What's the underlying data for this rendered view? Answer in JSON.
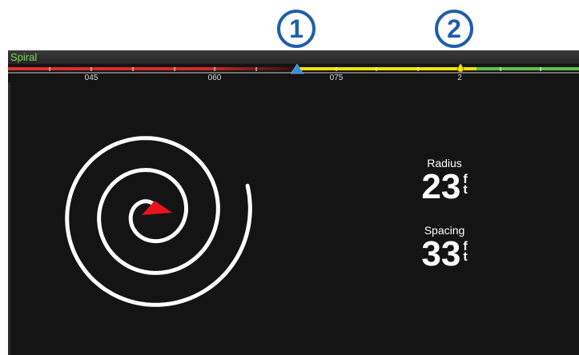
{
  "callouts": [
    "1",
    "2"
  ],
  "screen": {
    "title": "Spiral",
    "heading_ticks": [
      "045",
      "060",
      "075",
      "2"
    ],
    "colors": {
      "title": "#7ed957",
      "port_bar": "#e0302f",
      "course_line": "#f2e600",
      "starboard_bar": "#5cc445",
      "heading_marker": "#3a8fd6",
      "waypoint_marker": "#f2e600",
      "boat": "#e8141c",
      "spiral": "#ffffff"
    },
    "icons": [
      "heading-marker-icon",
      "waypoint-marker-icon",
      "boat-icon"
    ]
  },
  "readouts": {
    "radius": {
      "label": "Radius",
      "value": "23",
      "unit_top": "f",
      "unit_bottom": "t"
    },
    "spacing": {
      "label": "Spacing",
      "value": "33",
      "unit_top": "f",
      "unit_bottom": "t"
    }
  }
}
